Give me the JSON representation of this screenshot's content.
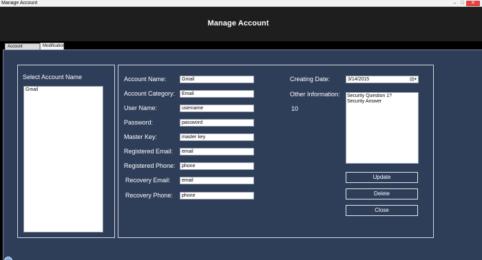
{
  "window": {
    "title": "Manage Account",
    "controls": {
      "minimize": "–",
      "maximize": "□",
      "close": "✕"
    }
  },
  "header": {
    "title": "Manage Account"
  },
  "tabs": [
    {
      "label": "Account Summary",
      "active": false
    },
    {
      "label": "Modification",
      "active": true
    }
  ],
  "left_panel": {
    "heading": "Select Account Name",
    "accounts": [
      "Gmail"
    ]
  },
  "form": {
    "fields": [
      {
        "label": "Account Name:",
        "value": "Gmail"
      },
      {
        "label": "Account Category:",
        "value": "Email"
      },
      {
        "label": "User Name:",
        "value": "username"
      },
      {
        "label": "Password:",
        "value": "password"
      },
      {
        "label": "Master Key:",
        "value": "master key"
      },
      {
        "label": "Registered Email:",
        "value": "email"
      },
      {
        "label": "Registered Phone:",
        "value": "phone"
      },
      {
        "label": "Recovery Email:",
        "value": "email"
      },
      {
        "label": "Recovery Phone:",
        "value": "phone"
      }
    ],
    "creating_date": {
      "label": "Creating Date:",
      "value": "3/14/2015",
      "icon": "calendar-dropdown-icon"
    },
    "other_information": {
      "label": "Other Information:",
      "count": "10",
      "lines": [
        "Security Question 1?",
        "Security Answer"
      ]
    },
    "buttons": {
      "update": "Update",
      "delete": "Delete",
      "close": "Close"
    }
  },
  "colors": {
    "panel_background": "#2e3e58",
    "header_background": "#1e1e1e",
    "border": "#d4d9e3"
  }
}
